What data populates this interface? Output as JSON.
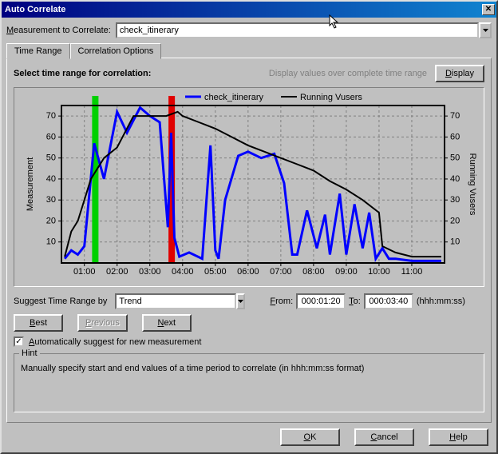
{
  "window": {
    "title": "Auto Correlate"
  },
  "measurement": {
    "label": "Measurement to Correlate:",
    "accel": "M",
    "value": "check_itinerary"
  },
  "tabs": {
    "time_range": "Time Range",
    "correlation_options": "Correlation Options"
  },
  "pane": {
    "heading": "Select time range for correlation:",
    "display_hint": "Display values over complete time range",
    "display_btn": "Display",
    "display_accel": "D"
  },
  "suggest": {
    "label": "Suggest Time Range by",
    "value": "Trend",
    "from_label": "From:",
    "from_accel": "F",
    "from_value": "000:01:20",
    "to_label": "To:",
    "to_accel": "T",
    "to_value": "000:03:40",
    "format": "(hhh:mm:ss)"
  },
  "nav": {
    "best": "Best",
    "best_accel": "B",
    "previous": "Previous",
    "previous_accel": "P",
    "next": "Next",
    "next_accel": "N"
  },
  "checkbox": {
    "label": "Automatically suggest for new measurement",
    "accel": "A",
    "checked": true
  },
  "hint": {
    "title": "Hint",
    "text": "Manually specify start and end values of a time period to correlate (in hhh:mm:ss format)"
  },
  "buttons": {
    "ok": "OK",
    "ok_accel": "O",
    "cancel": "Cancel",
    "cancel_accel": "C",
    "help": "Help",
    "help_accel": "H"
  },
  "chart_data": {
    "type": "line",
    "title": "",
    "xlabel": "",
    "ylabel_left": "Measurement",
    "ylabel_right": "Running Vusers",
    "x_ticks": [
      "01:00",
      "02:00",
      "03:00",
      "04:00",
      "05:00",
      "06:00",
      "07:00",
      "08:00",
      "09:00",
      "10:00",
      "11:00"
    ],
    "y_ticks": [
      10,
      20,
      30,
      40,
      50,
      60,
      70
    ],
    "ylim": [
      0,
      75
    ],
    "legend": [
      "check_itinerary",
      "Running Vusers"
    ],
    "selection": {
      "start": "000:01:20",
      "end": "000:03:40"
    },
    "series": [
      {
        "name": "check_itinerary",
        "color": "#0000ff",
        "x": [
          0.4,
          0.6,
          0.8,
          1.0,
          1.3,
          1.6,
          2.0,
          2.3,
          2.7,
          3.0,
          3.3,
          3.55,
          3.65,
          3.75,
          3.9,
          4.2,
          4.6,
          4.85,
          5.0,
          5.1,
          5.3,
          5.7,
          6.0,
          6.4,
          6.8,
          7.1,
          7.35,
          7.5,
          7.8,
          8.1,
          8.35,
          8.5,
          8.8,
          9.0,
          9.25,
          9.5,
          9.7,
          9.9,
          10.1,
          10.3,
          10.5,
          11.0,
          11.5,
          11.9
        ],
        "y": [
          2,
          6,
          4,
          8,
          57,
          40,
          72,
          62,
          74,
          70,
          67,
          17,
          62,
          12,
          3,
          5,
          2,
          56,
          6,
          2,
          30,
          51,
          53,
          50,
          52,
          38,
          4,
          4,
          25,
          7,
          23,
          4,
          33,
          4,
          28,
          7,
          24,
          2,
          7,
          2,
          2,
          1,
          1,
          1
        ]
      },
      {
        "name": "Running Vusers",
        "color": "#000000",
        "x": [
          0.4,
          0.6,
          0.8,
          1.0,
          1.2,
          1.4,
          1.6,
          2.0,
          2.5,
          3.0,
          3.5,
          3.85,
          4.0,
          4.5,
          5.0,
          5.5,
          6.0,
          6.5,
          7.0,
          7.5,
          8.0,
          8.5,
          9.0,
          9.5,
          10.0,
          10.1,
          10.5,
          11.0,
          11.5,
          11.9
        ],
        "y": [
          3,
          15,
          20,
          30,
          40,
          45,
          50,
          55,
          70,
          70,
          70,
          72,
          70,
          67,
          64,
          60,
          56,
          53,
          50,
          47,
          44,
          39,
          35,
          30,
          24,
          8,
          5,
          3,
          3,
          3
        ]
      }
    ]
  }
}
